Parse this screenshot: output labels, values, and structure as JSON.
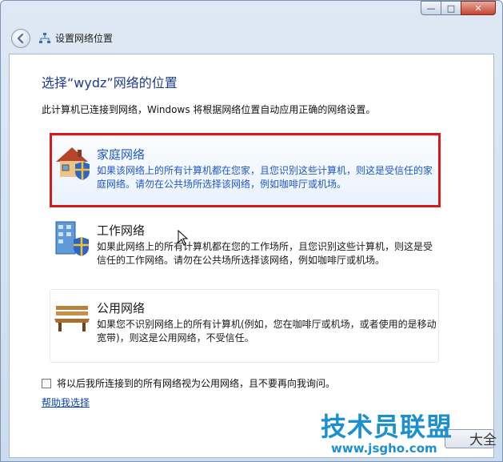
{
  "window": {
    "nav_title": "设置网络位置",
    "minimize_glyph": "—",
    "maximize_glyph": "□",
    "close_glyph": "✕"
  },
  "main": {
    "heading": "选择“wydz”网络的位置",
    "description": "此计算机已连接到网络，Windows 将根据网络位置自动应用正确的网络设置。"
  },
  "options": [
    {
      "title": "家庭网络",
      "text": "如果该网络上的所有计算机都在您家，且您识别这些计算机，则这是受信任的家庭网络。请勿在公共场所选择该网络，例如咖啡厅或机场。",
      "icon": "home-icon"
    },
    {
      "title": "工作网络",
      "text": "如果此网络上的所有计算机都在您的工作场所，且您识别这些计算机，则这是受信任的工作网络。请勿在公共场所选择该网络，例如咖啡厅或机场。",
      "icon": "office-building-icon"
    },
    {
      "title": "公用网络",
      "text": "如果您不识别网络上的所有计算机(例如，您在咖啡厅或机场，或者使用的是移动宽带)，则这是公用网络，不受信任。",
      "icon": "park-bench-icon"
    }
  ],
  "checkbox": {
    "label": "将以后我所连接到的所有网络视为公用网络，且不要再向我询问。",
    "checked": false
  },
  "help_link": "帮助我选择",
  "watermark": {
    "main": "技术员联盟",
    "url": "www.jsgho.com",
    "small": "大全"
  },
  "colors": {
    "accent_link": "#1f57c7",
    "highlight_box": "#d7191c",
    "watermark": "#1c8fd0"
  }
}
